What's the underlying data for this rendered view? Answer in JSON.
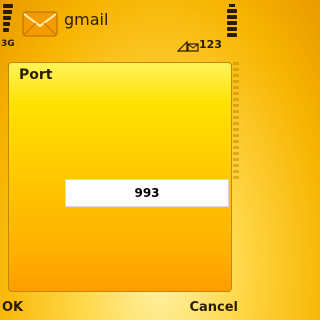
{
  "status": {
    "network": "3G",
    "app_title": "gmail",
    "unread_count": "123",
    "app_icon": "envelope-icon",
    "message_icon": "message-indicator-icon"
  },
  "dialog": {
    "title": "Port",
    "value": "993"
  },
  "softkeys": {
    "left": "OK",
    "right": "Cancel"
  },
  "colors": {
    "accent": "#ffc400",
    "text": "#2a1c00"
  }
}
